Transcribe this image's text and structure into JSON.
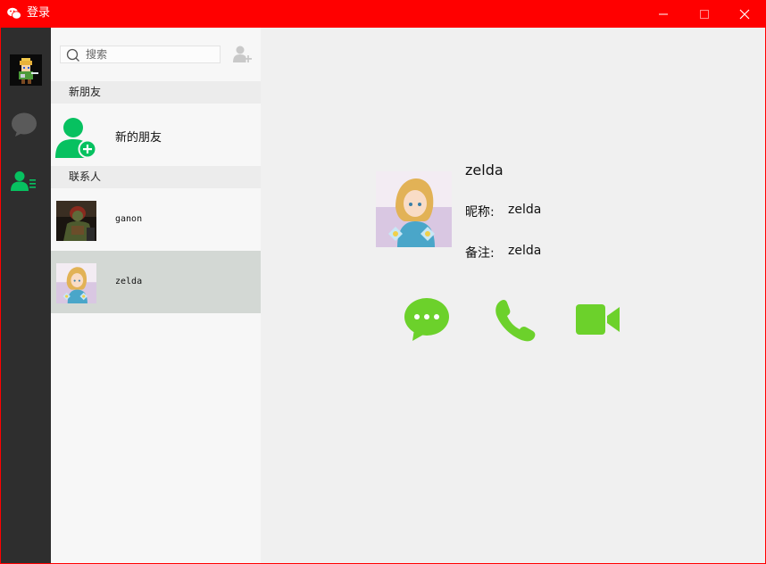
{
  "window": {
    "title": "登录",
    "accent_color": "#ff0000",
    "controls": [
      "minimize-icon",
      "maximize-icon",
      "close-icon"
    ]
  },
  "navbar": {
    "background": "#2e2e2e",
    "items": [
      "avatar",
      "chat-bubble-icon",
      "contacts-icon"
    ],
    "active_color": "#07c160"
  },
  "contacts_pane": {
    "search": {
      "placeholder": "搜索",
      "value": ""
    },
    "add_button_icon": "add-contact-icon",
    "sections": [
      {
        "header": "新朋友",
        "items": [
          {
            "label": "新的朋友",
            "icon": "new-friend-icon"
          }
        ]
      },
      {
        "header": "联系人",
        "items": [
          {
            "name": "ganon",
            "selected": false
          },
          {
            "name": "zelda",
            "selected": true
          }
        ]
      }
    ]
  },
  "detail": {
    "name": "zelda",
    "nickname_label": "昵称:",
    "nickname_value": "zelda",
    "remark_label": "备注:",
    "remark_value": "zelda",
    "actions": [
      "message-icon",
      "voice-call-icon",
      "video-call-icon"
    ],
    "action_color": "#6cd12b"
  }
}
